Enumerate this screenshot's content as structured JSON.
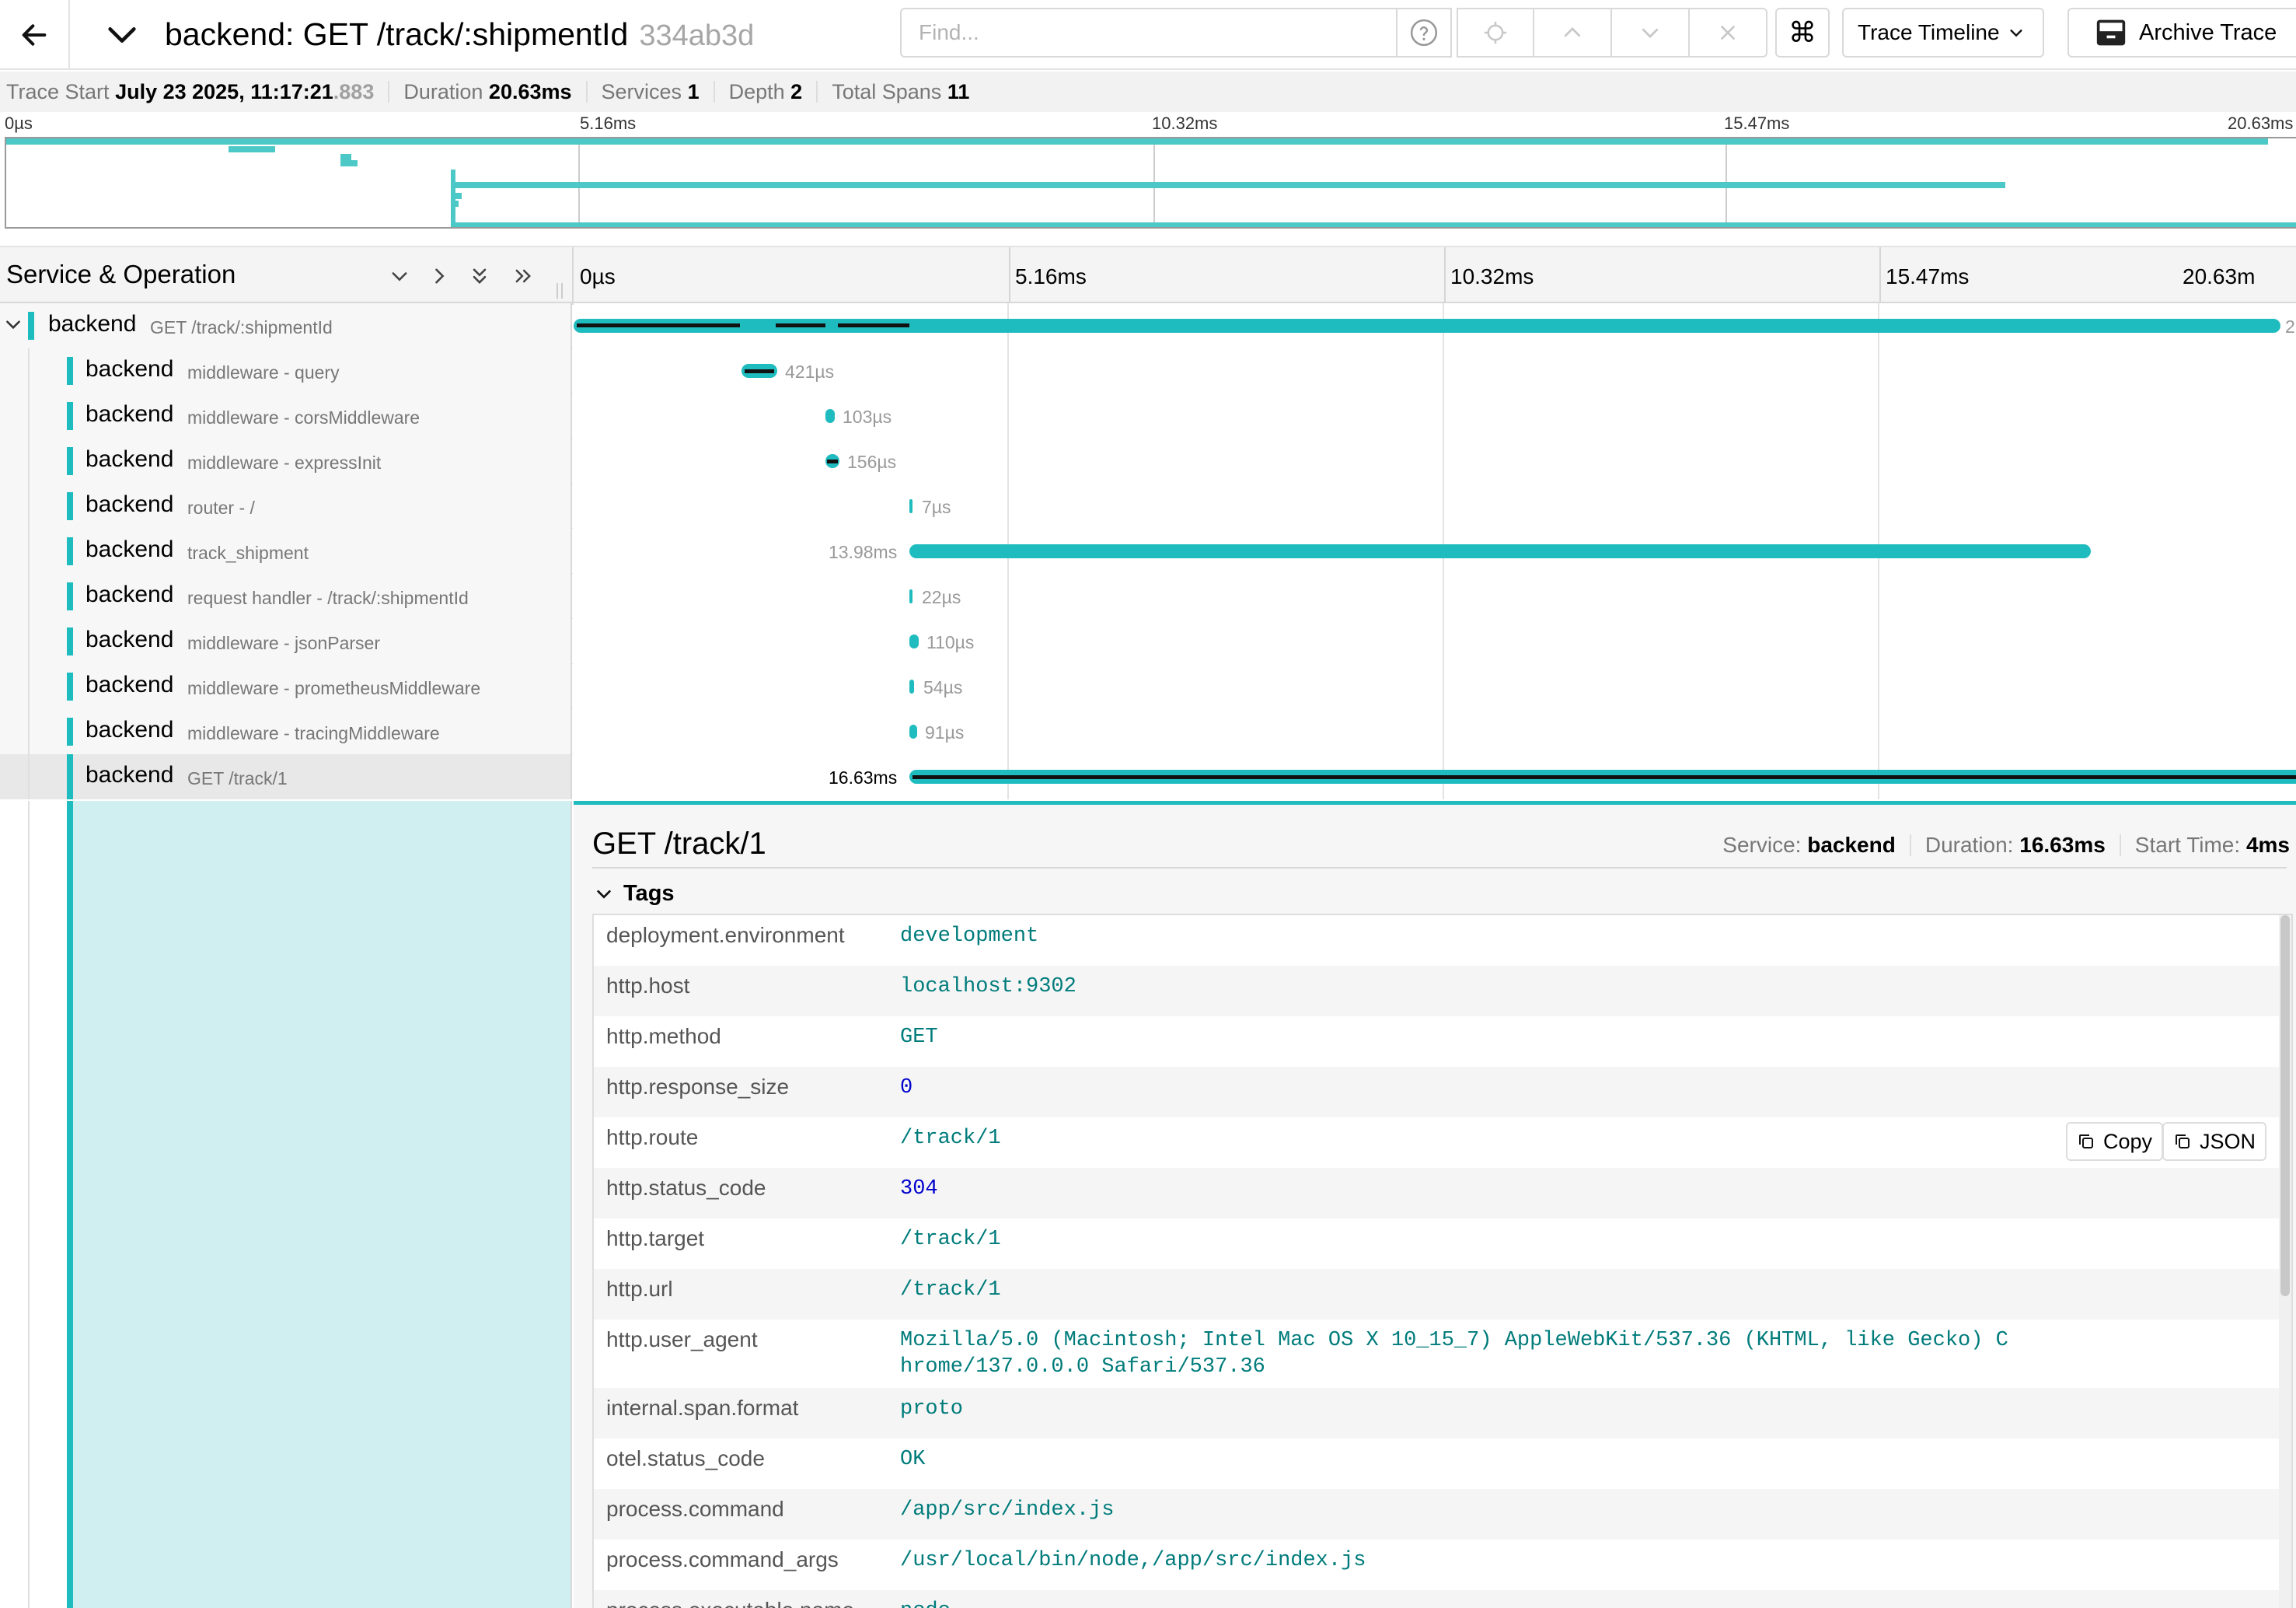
{
  "header": {
    "title": "backend: GET /track/:shipmentId",
    "trace_id": "334ab3d",
    "find_placeholder": "Find...",
    "view_select_label": "Trace Timeline",
    "archive_label": "Archive Trace",
    "kbd_symbol": "⌘"
  },
  "summary": {
    "trace_start_label": "Trace Start",
    "trace_start_value": "July 23 2025, 11:17:21",
    "trace_start_ms": ".883",
    "duration_label": "Duration",
    "duration_value": "20.63ms",
    "services_label": "Services",
    "services_value": "1",
    "depth_label": "Depth",
    "depth_value": "2",
    "total_spans_label": "Total Spans",
    "total_spans_value": "11"
  },
  "minimap": {
    "ticks": [
      "0µs",
      "5.16ms",
      "10.32ms",
      "15.47ms",
      "20.63ms"
    ]
  },
  "timeline_header": {
    "service_operation_label": "Service & Operation",
    "ticks": [
      "0µs",
      "5.16ms",
      "10.32ms",
      "15.47ms",
      "20.63m"
    ]
  },
  "spans": [
    {
      "service": "backend",
      "operation": "GET /track/:shipmentId",
      "start_ms": 0.0,
      "duration_ms": 20.63,
      "duration_label": "2",
      "depth": 0
    },
    {
      "service": "backend",
      "operation": "middleware - query",
      "start_ms": 2.0,
      "duration_ms": 0.421,
      "duration_label": "421µs",
      "depth": 1
    },
    {
      "service": "backend",
      "operation": "middleware - corsMiddleware",
      "start_ms": 3.0,
      "duration_ms": 0.103,
      "duration_label": "103µs",
      "depth": 1
    },
    {
      "service": "backend",
      "operation": "middleware - expressInit",
      "start_ms": 3.0,
      "duration_ms": 0.156,
      "duration_label": "156µs",
      "depth": 1
    },
    {
      "service": "backend",
      "operation": "router - /",
      "start_ms": 4.0,
      "duration_ms": 0.007,
      "duration_label": "7µs",
      "depth": 1
    },
    {
      "service": "backend",
      "operation": "track_shipment",
      "start_ms": 4.0,
      "duration_ms": 13.98,
      "duration_label": "13.98ms",
      "depth": 1
    },
    {
      "service": "backend",
      "operation": "request handler - /track/:shipmentId",
      "start_ms": 4.0,
      "duration_ms": 0.022,
      "duration_label": "22µs",
      "depth": 1
    },
    {
      "service": "backend",
      "operation": "middleware - jsonParser",
      "start_ms": 4.0,
      "duration_ms": 0.11,
      "duration_label": "110µs",
      "depth": 1
    },
    {
      "service": "backend",
      "operation": "middleware - prometheusMiddleware",
      "start_ms": 4.0,
      "duration_ms": 0.054,
      "duration_label": "54µs",
      "depth": 1
    },
    {
      "service": "backend",
      "operation": "middleware - tracingMiddleware",
      "start_ms": 4.0,
      "duration_ms": 0.091,
      "duration_label": "91µs",
      "depth": 1
    },
    {
      "service": "backend",
      "operation": "GET /track/1",
      "start_ms": 4.0,
      "duration_ms": 16.63,
      "duration_label": "16.63ms",
      "depth": 1
    }
  ],
  "detail": {
    "title": "GET /track/1",
    "service_label": "Service:",
    "service_value": "backend",
    "duration_label": "Duration:",
    "duration_value": "16.63ms",
    "start_label": "Start Time:",
    "start_value": "4ms",
    "tags_label": "Tags",
    "copy_label": "Copy",
    "json_label": "JSON",
    "tags": [
      {
        "key": "deployment.environment",
        "value": "development",
        "kind": "str"
      },
      {
        "key": "http.host",
        "value": "localhost:9302",
        "kind": "str"
      },
      {
        "key": "http.method",
        "value": "GET",
        "kind": "str"
      },
      {
        "key": "http.response_size",
        "value": "0",
        "kind": "num"
      },
      {
        "key": "http.route",
        "value": "/track/1",
        "kind": "str"
      },
      {
        "key": "http.status_code",
        "value": "304",
        "kind": "num"
      },
      {
        "key": "http.target",
        "value": "/track/1",
        "kind": "str"
      },
      {
        "key": "http.url",
        "value": "/track/1",
        "kind": "str"
      },
      {
        "key": "http.user_agent",
        "value": "Mozilla/5.0 (Macintosh; Intel Mac OS X 10_15_7) AppleWebKit/537.36 (KHTML, like Gecko) Chrome/137.0.0.0 Safari/537.36",
        "kind": "str"
      },
      {
        "key": "internal.span.format",
        "value": "proto",
        "kind": "str"
      },
      {
        "key": "otel.status_code",
        "value": "OK",
        "kind": "str"
      },
      {
        "key": "process.command",
        "value": "/app/src/index.js",
        "kind": "str"
      },
      {
        "key": "process.command_args",
        "value": "/usr/local/bin/node,/app/src/index.js",
        "kind": "str"
      },
      {
        "key": "process.executable.name",
        "value": "node",
        "kind": "str"
      }
    ]
  },
  "colors": {
    "service": "#1fbcbf",
    "selection_fill": "#d0eff0",
    "tag_value": "#007b7b",
    "tag_number": "#0000cc"
  }
}
